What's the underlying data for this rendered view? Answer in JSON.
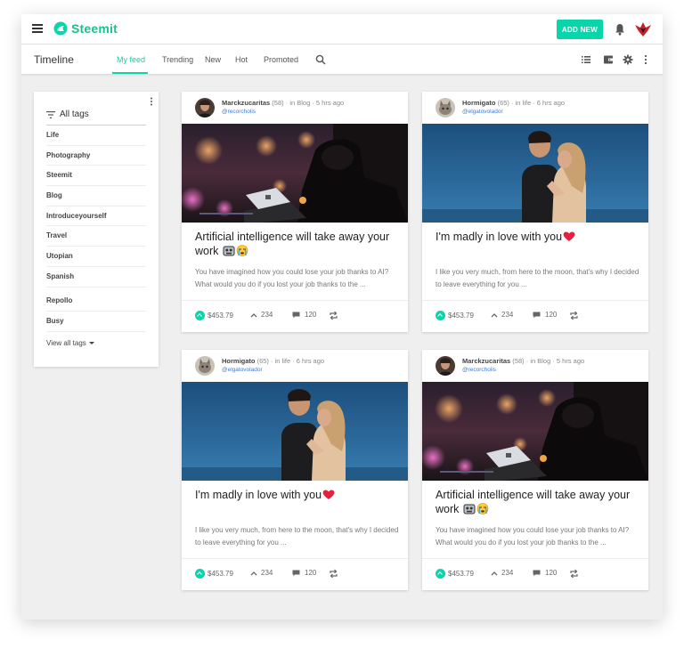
{
  "app": {
    "name": "Steemit",
    "brand_color": "#06d6a9"
  },
  "header": {
    "add_new_label": "ADD NEW"
  },
  "tabbar": {
    "title": "Timeline",
    "tabs": [
      {
        "label": "My feed",
        "active": true
      },
      {
        "label": "Trending",
        "active": false
      },
      {
        "label": "New",
        "active": false
      },
      {
        "label": "Hot",
        "active": false
      },
      {
        "label": "Promoted",
        "active": false
      }
    ]
  },
  "sidebar": {
    "heading": "All tags",
    "tags": [
      "Life",
      "Photography",
      "Steemit",
      "Blog",
      "Introduceyourself",
      "Travel",
      "Utopian",
      "Spanish",
      "Repollo",
      "Busy"
    ],
    "view_all": "View all tags"
  },
  "posts": [
    {
      "author": "Marckzucaritas",
      "reputation": "(58)",
      "context": "· in Blog · 5 hrs ago",
      "handle": "@recorcholis",
      "image": "laptop-night-photo",
      "title": "Artificial intelligence will take away your work",
      "title_emojis": [
        "robot-face-icon",
        "crying-face-icon"
      ],
      "excerpt": "You have imagined how you could lose your job thanks to AI? What would you do if you lost your job thanks to the ...",
      "payout": "$453.79",
      "votes": "234",
      "comments": "120"
    },
    {
      "author": "Hormigato",
      "reputation": "(65)",
      "context": "· in life · 6 hrs ago",
      "handle": "@elgatovolador",
      "image": "couple-kissing-photo",
      "title": "I'm madly in love with you",
      "title_emojis": [
        "heart-icon"
      ],
      "excerpt": "I like you very much, from here to the moon, that's why I decided to leave everything for you ...",
      "payout": "$453.79",
      "votes": "234",
      "comments": "120"
    },
    {
      "author": "Hormigato",
      "reputation": "(65)",
      "context": "· in life · 6 hrs ago",
      "handle": "@elgatovolador",
      "image": "couple-kissing-photo",
      "title": "I'm madly in love with you",
      "title_emojis": [
        "heart-icon"
      ],
      "excerpt": "I like you very much, from here to the moon, that's why I decided to leave everything for you ...",
      "payout": "$453.79",
      "votes": "234",
      "comments": "120"
    },
    {
      "author": "Marckzucaritas",
      "reputation": "(58)",
      "context": "· in Blog · 5 hrs ago",
      "handle": "@recorcholis",
      "image": "laptop-night-photo",
      "title": "Artificial intelligence will take away your work",
      "title_emojis": [
        "robot-face-icon",
        "crying-face-icon"
      ],
      "excerpt": "You have imagined how you could lose your job thanks to AI? What would you do if you lost your job thanks to the ...",
      "payout": "$453.79",
      "votes": "234",
      "comments": "120"
    }
  ]
}
